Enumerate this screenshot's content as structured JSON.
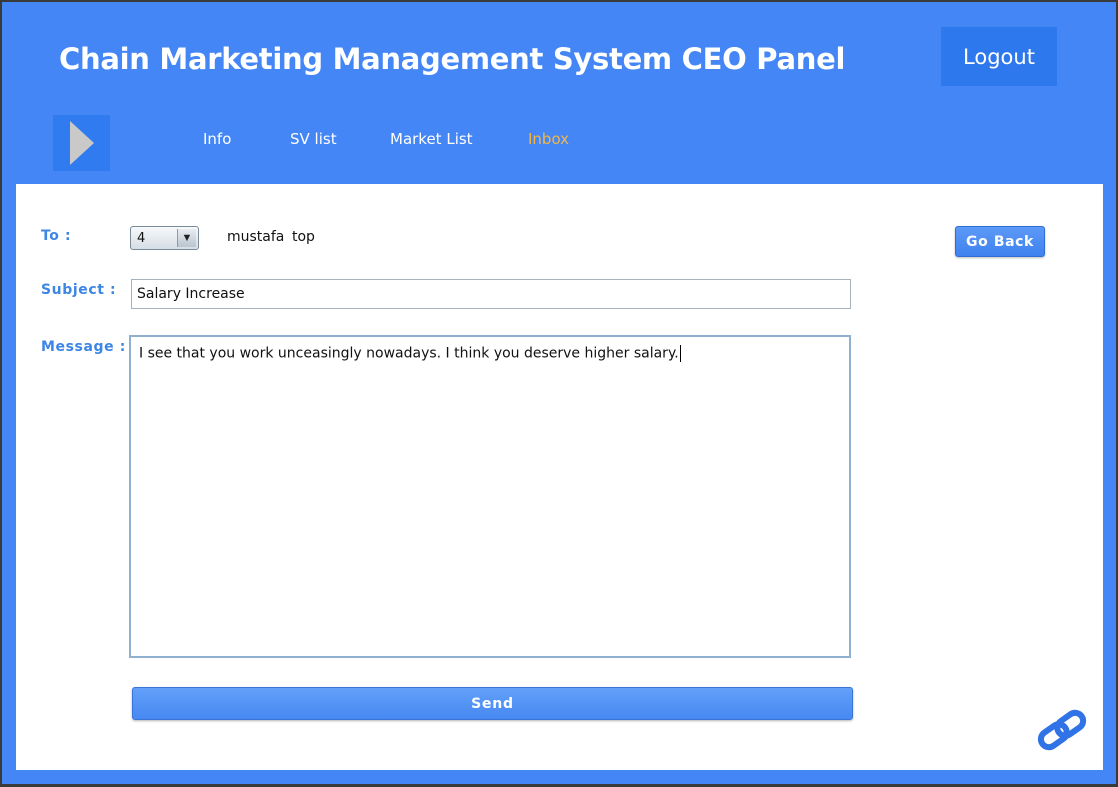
{
  "header": {
    "title": "Chain Marketing Management System CEO Panel",
    "logout_label": "Logout"
  },
  "nav": {
    "items": [
      {
        "label": "Info",
        "active": false
      },
      {
        "label": "SV list",
        "active": false
      },
      {
        "label": "Market List",
        "active": false
      },
      {
        "label": "Inbox",
        "active": true
      }
    ]
  },
  "compose": {
    "to_label": "To :",
    "to_selected": "4",
    "recipient_first": "mustafa",
    "recipient_last": "top",
    "subject_label": "Subject :",
    "subject_value": "Salary Increase",
    "message_label": "Message :",
    "message_value": "I see that you work unceasingly nowadays. I think you deserve higher salary.",
    "send_label": "Send",
    "go_back_label": "Go Back"
  },
  "icons": {
    "menu": "triangle-right-icon",
    "footer": "chain-link-icon"
  },
  "colors": {
    "header_bg": "#4486f6",
    "active_nav": "#f5b642",
    "label": "#3d86e6",
    "button": "#4788f2"
  }
}
